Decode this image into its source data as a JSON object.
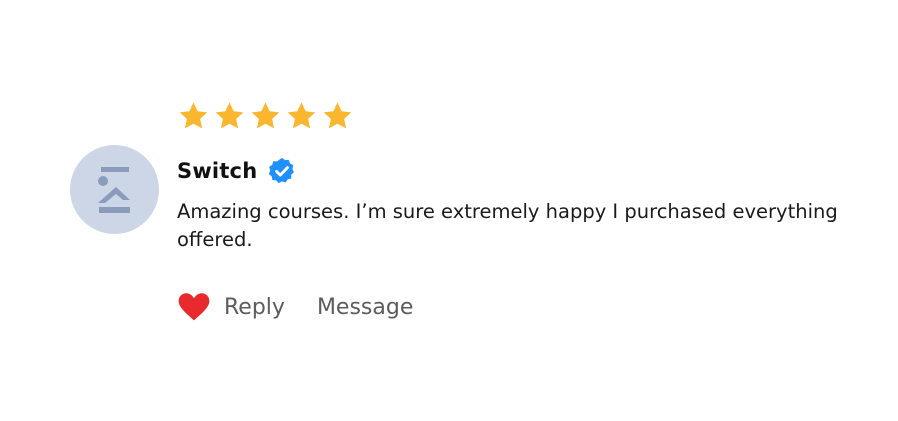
{
  "rating": {
    "value": 5,
    "max": 5,
    "star_color": "#fbb62f"
  },
  "review": {
    "author": "Switch",
    "verified": true,
    "verified_color": "#1e90ff",
    "text": "Amazing courses. I’m sure extremely happy I purchased everything offered."
  },
  "actions": {
    "like_icon": "heart-icon",
    "like_color": "#e8292e",
    "reply_label": "Reply",
    "message_label": "Message"
  },
  "avatar": {
    "icon": "broken-image-placeholder-icon",
    "background": "#cdd6e6"
  }
}
